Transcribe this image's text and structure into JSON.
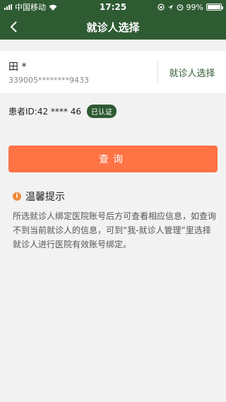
{
  "status_bar": {
    "carrier": "中国移动",
    "time": "17:25",
    "battery": "99%"
  },
  "nav": {
    "title": "就诊人选择",
    "back_icon": "chevron-left-icon"
  },
  "patient": {
    "name": "田 *",
    "id_card": "339005********9433",
    "select_label": "就诊人选择",
    "patient_id_text": "患者ID:42 **** 46",
    "verified_badge": "已认证"
  },
  "query_button": "查询",
  "tips": {
    "title": "温馨提示",
    "icon": "info-icon",
    "body": "所选就诊人绑定医院账号后方可查看相应信息，如查询 不到当前就诊人的信息，可到“我-就诊人管理”里选择就诊人进行医院有效账号绑定。"
  },
  "colors": {
    "brand": "#2f5b33",
    "accent": "#ff7344"
  }
}
